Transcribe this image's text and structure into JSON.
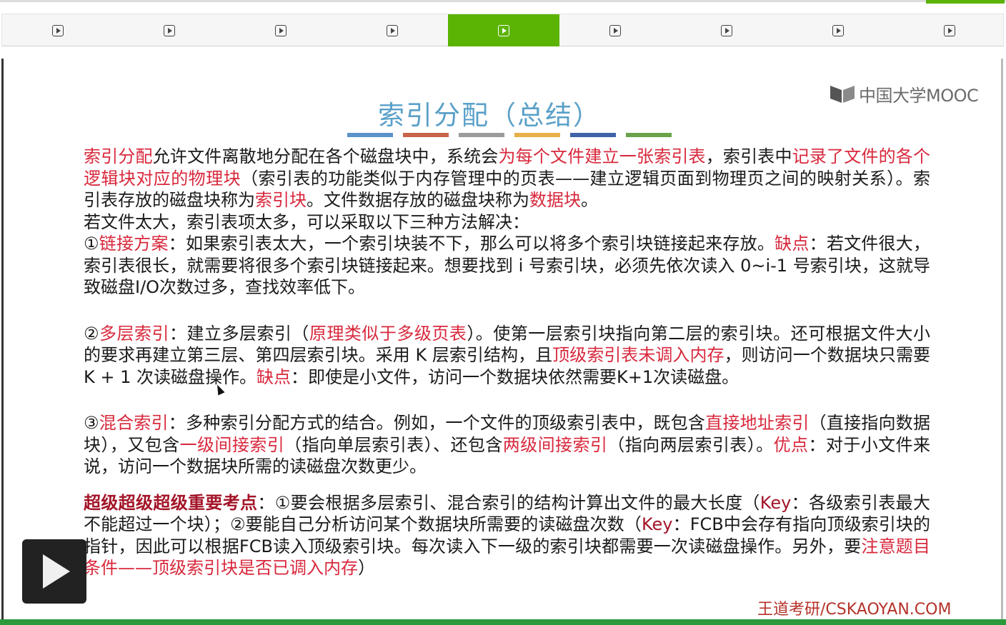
{
  "nav": {
    "tabs": [
      {
        "icon": "play-icon",
        "active": false
      },
      {
        "icon": "play-icon",
        "active": false
      },
      {
        "icon": "play-icon",
        "active": false
      },
      {
        "icon": "play-icon",
        "active": false
      },
      {
        "icon": "play-icon",
        "active": true
      },
      {
        "icon": "play-icon",
        "active": false
      },
      {
        "icon": "play-icon",
        "active": false
      },
      {
        "icon": "play-icon",
        "active": false
      },
      {
        "icon": "play-icon",
        "active": false
      }
    ],
    "active_color": "#5bb304"
  },
  "logo": {
    "text": "中国大学MOOC"
  },
  "slide": {
    "title": "索引分配（总结）",
    "title_bar_colors": [
      "#5b93c8",
      "#c8644a",
      "#9b9b9b",
      "#e8b04a",
      "#3f63a8",
      "#6aa24a"
    ],
    "p1": {
      "s1": "索引分配",
      "s2": "允许文件离散地分配在各个磁盘块中，系统会",
      "s3": "为每个文件建立一张索引表",
      "s4": "，索引表中",
      "s5": "记录了文件的各个逻辑块对应的物理块",
      "s6": "（索引表的功能类似于内存管理中的页表——建立逻辑页面到物理页之间的映射关系）。索引表存放的磁盘块称为",
      "s7": "索引块",
      "s8": "。文件数据存放的磁盘块称为",
      "s9": "数据块",
      "s10": "。"
    },
    "p2": "若文件太大，索引表项太多，可以采取以下三种方法解决：",
    "p3": {
      "s1": "①",
      "s2": "链接方案",
      "s3": "：如果索引表太大，一个索引块装不下，那么可以将多个索引块链接起来存放。",
      "s4": "缺点",
      "s5": "：若文件很大，索引表很长，就需要将很多个索引块链接起来。想要找到 i 号索引块，必须先依次读入 0~i-1 号索引块，这就导致磁盘I/O次数过多，查找效率低下。"
    },
    "p4": {
      "s1": "②",
      "s2": "多层索引",
      "s3": "：建立多层索引（",
      "s4": "原理类似于多级页表",
      "s5": "）。使第一层索引块指向第二层的索引块。还可根据文件大小的要求再建立第三层、第四层索引块。采用 K 层索引结构，且",
      "s6": "顶级索引表未调入内存",
      "s7": "，则访问一个数据块只需要 K + 1 次读磁盘操作。",
      "s8": "缺点",
      "s9": "：即使是小文件，访问一个数据块依然需要K+1次读磁盘。"
    },
    "p5": {
      "s1": "③",
      "s2": "混合索引",
      "s3": "：多种索引分配方式的结合。例如，一个文件的顶级索引表中，既包含",
      "s4": "直接地址索引",
      "s5": "（直接指向数据块），又包含",
      "s6": "一级间接索引",
      "s7": "（指向单层索引表）、还包含",
      "s8": "两级间接索引",
      "s9": "（指向两层索引表）。",
      "s10": "优点",
      "s11": "：对于小文件来说，访问一个数据块所需的读磁盘次数更少。"
    },
    "p6": {
      "s1": "超级超级超级重要考点",
      "s2": "：①要会根据多层索引、混合索引的结构计算出文件的最大长度（",
      "s3": "Key",
      "s4": "：各级索引表最大不能超过一个块）；②要能自己分析访问某个数据块所需要的读磁盘次数（",
      "s5": "Key",
      "s6": "：FCB中会存有指向顶级索引块的指针，因此可以根据FCB读入顶级索引块。每次读入下一级的索引块都需要一次读磁盘操作。另外，要",
      "s7": "注意题目条件——顶级索引块是否已调入内存",
      "s8": "）"
    }
  },
  "watermark": "王道考研/CSKAOYAN.COM",
  "player": {
    "play_button_icon": "play-icon"
  }
}
